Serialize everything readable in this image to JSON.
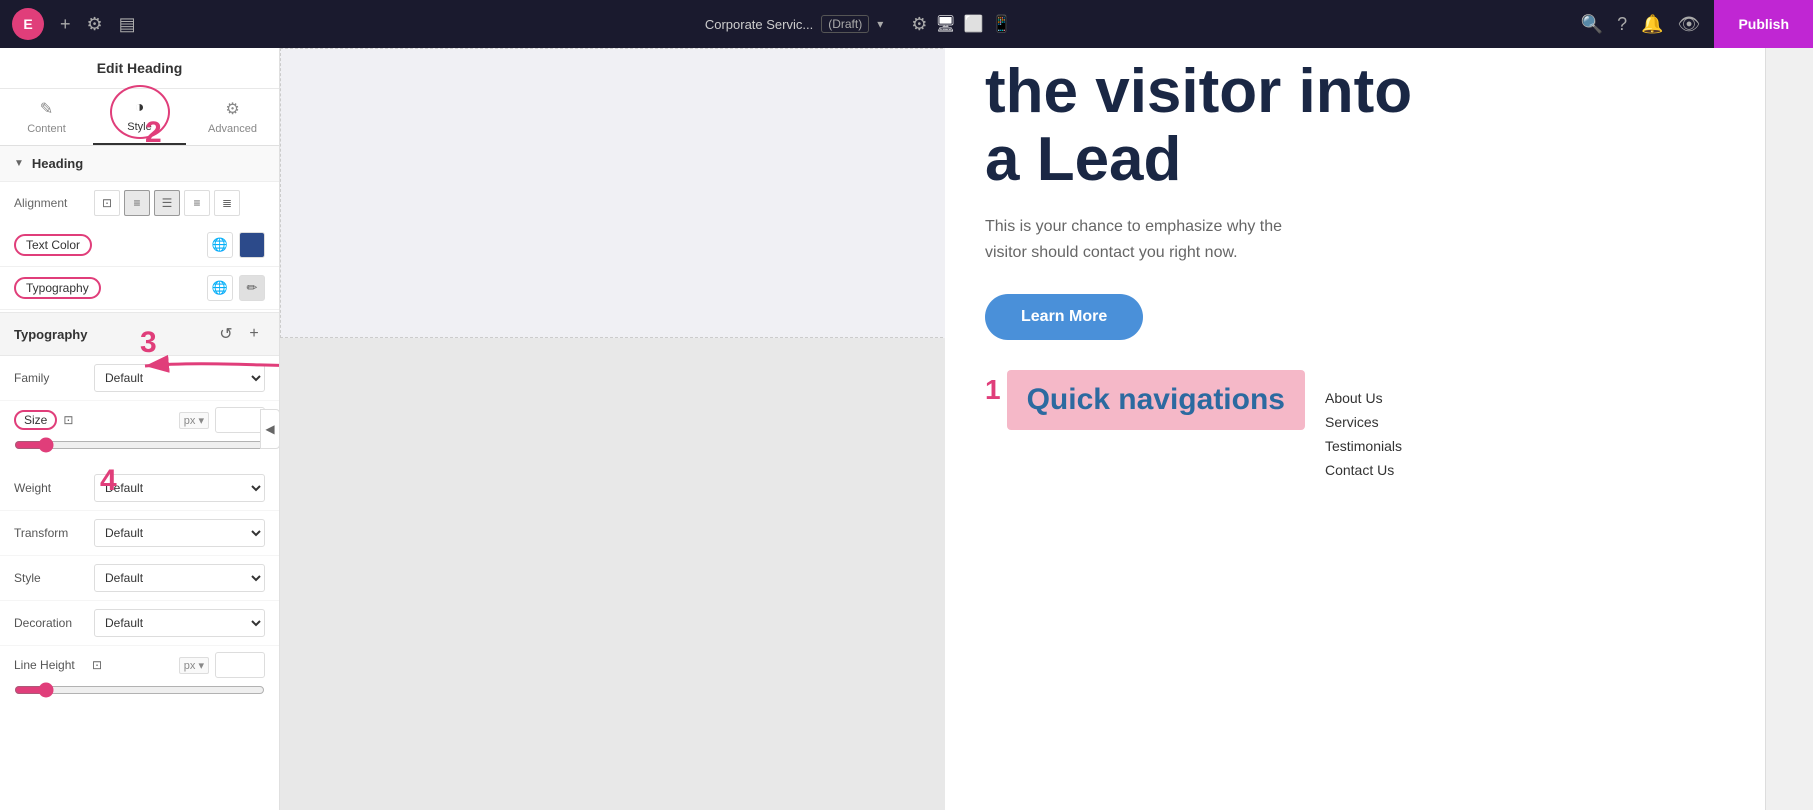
{
  "topbar": {
    "logo_label": "E",
    "site_title": "Corporate Servic...",
    "draft_label": "(Draft)",
    "publish_label": "Publish"
  },
  "left_panel": {
    "header": "Edit Heading",
    "tabs": [
      {
        "id": "content",
        "label": "Content",
        "icon": "✎"
      },
      {
        "id": "style",
        "label": "Style",
        "icon": "◑",
        "active": true
      },
      {
        "id": "advanced",
        "label": "Advanced",
        "icon": "⚙"
      }
    ],
    "heading_section": {
      "title": "Heading",
      "alignment": {
        "label": "Alignment",
        "options": [
          "desktop",
          "left",
          "center",
          "right",
          "justify"
        ]
      },
      "text_color": {
        "label": "Text Color"
      },
      "typography": {
        "label": "Typography"
      }
    },
    "typography_section": {
      "title": "Typography",
      "family": {
        "label": "Family",
        "value": "Default"
      },
      "size": {
        "label": "Size",
        "unit": "px ▾",
        "value": ""
      },
      "weight": {
        "label": "Weight",
        "value": "Default"
      },
      "transform": {
        "label": "Transform",
        "value": "Default"
      },
      "style": {
        "label": "Style",
        "value": "Default"
      },
      "decoration": {
        "label": "Decoration",
        "value": "Default"
      },
      "line_height": {
        "label": "Line Height",
        "unit": "px ▾",
        "value": ""
      }
    }
  },
  "canvas": {
    "hero_heading_line1": "the visitor into",
    "hero_heading_line2": "a Lead",
    "hero_subtext": "This is your chance to emphasize why the visitor should contact you right now.",
    "learn_more_label": "Learn More",
    "quick_nav_number": "1",
    "quick_nav_title": "Quick navigations",
    "nav_links": [
      "About Us",
      "Services",
      "Testimonials",
      "Contact Us"
    ]
  },
  "annotations": {
    "num2_label": "2",
    "num3_label": "3",
    "num4_label": "4"
  }
}
